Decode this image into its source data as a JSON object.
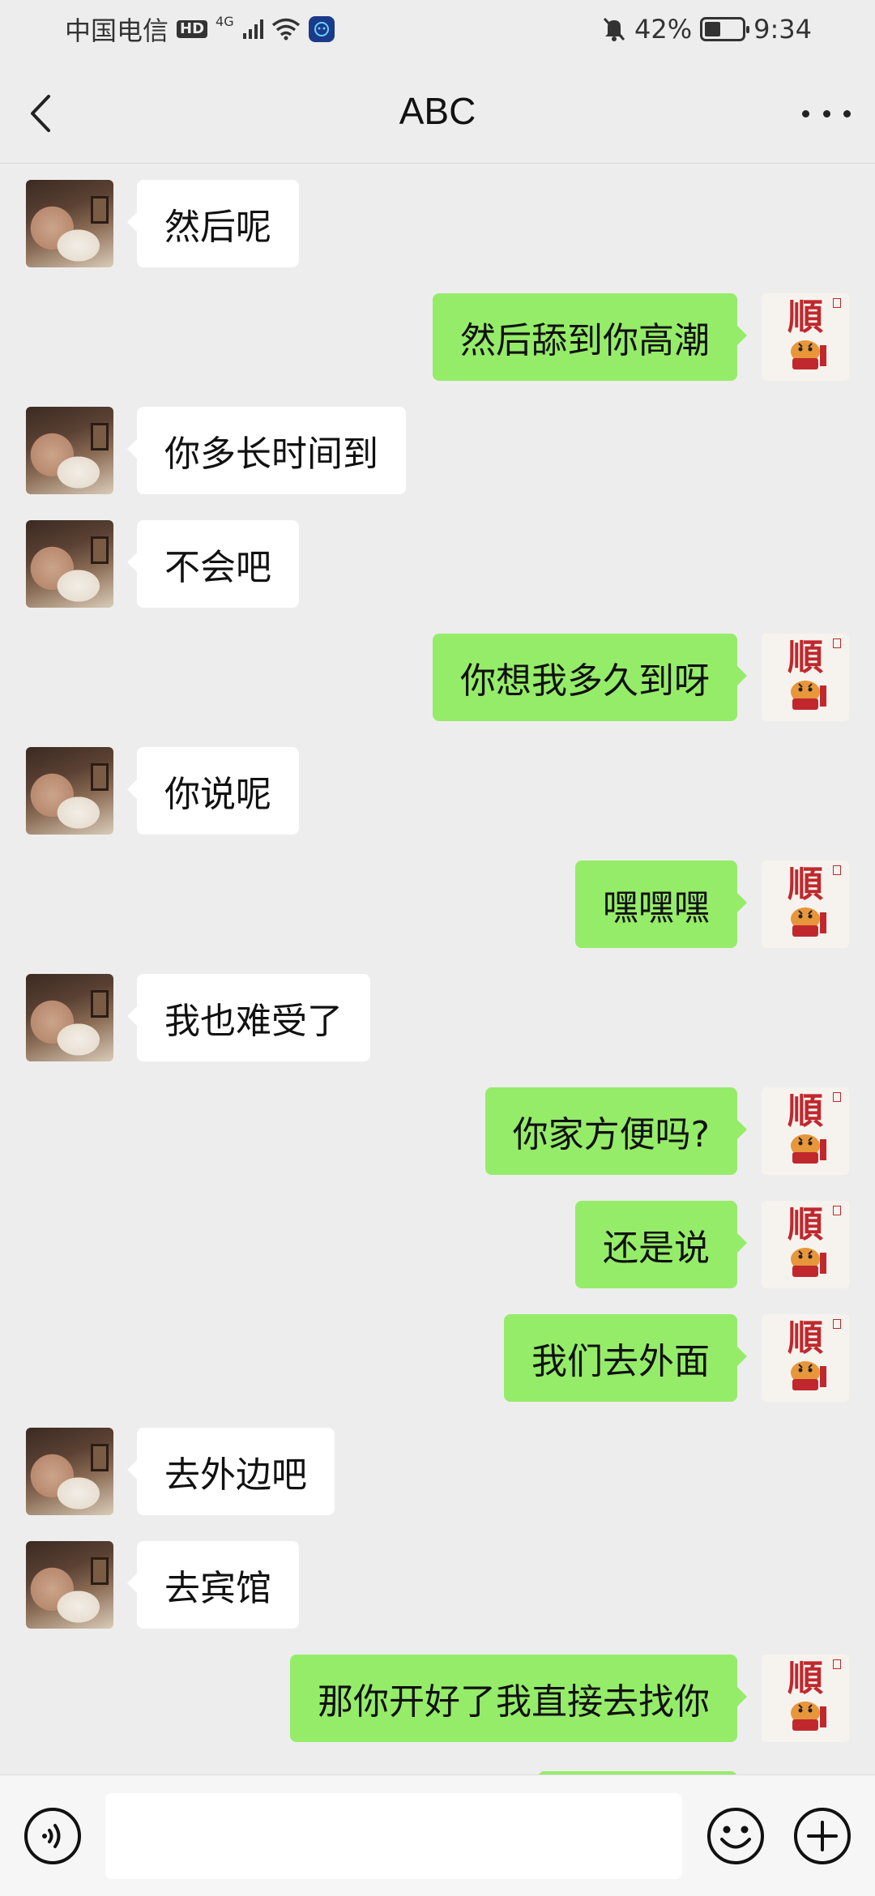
{
  "status_bar": {
    "carrier": "中国电信",
    "hd_badge": "HD",
    "network": "4G",
    "battery": "42%",
    "battery_level": 0.42,
    "time": "9:34"
  },
  "header": {
    "title": "ABC",
    "back_icon": "chevron-left-icon",
    "more_icon": "more-dots-icon"
  },
  "avatars": {
    "contact": "contact-avatar",
    "self": "self-avatar-shun-tiger",
    "self_glyph": "順"
  },
  "messages": [
    {
      "side": "left",
      "text": "然后呢"
    },
    {
      "side": "right",
      "text": "然后舔到你高潮"
    },
    {
      "side": "left",
      "text": "你多长时间到"
    },
    {
      "side": "left",
      "text": "不会吧"
    },
    {
      "side": "right",
      "text": "你想我多久到呀"
    },
    {
      "side": "left",
      "text": "你说呢"
    },
    {
      "side": "right",
      "text": "嘿嘿嘿"
    },
    {
      "side": "left",
      "text": "我也难受了"
    },
    {
      "side": "right",
      "text": "你家方便吗?"
    },
    {
      "side": "right",
      "text": "还是说"
    },
    {
      "side": "right",
      "text": "我们去外面"
    },
    {
      "side": "left",
      "text": "去外边吧"
    },
    {
      "side": "left",
      "text": "去宾馆"
    },
    {
      "side": "right",
      "text": "那你开好了我直接去找你"
    }
  ],
  "input_bar": {
    "value": "",
    "placeholder": "",
    "voice_icon": "voice-icon",
    "emoji_icon": "emoji-icon",
    "plus_icon": "plus-icon"
  },
  "colors": {
    "background": "#ededed",
    "bubble_self": "#95ec69",
    "bubble_contact": "#ffffff"
  }
}
